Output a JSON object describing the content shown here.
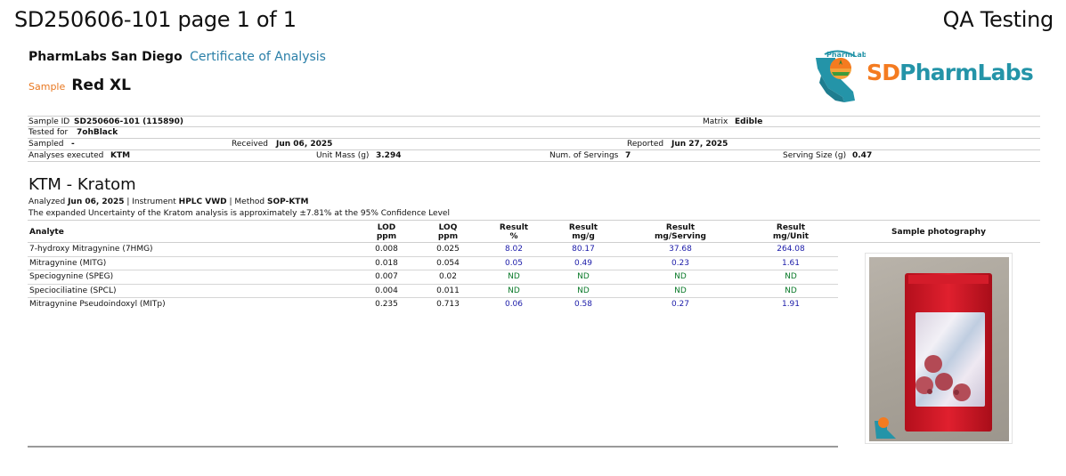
{
  "page": {
    "title": "SD250606-101 page 1 of 1",
    "right_title": "QA Testing"
  },
  "lab": {
    "name": "PharmLabs San Diego",
    "doc_type": "Certificate of Analysis",
    "logo_text_sd": "SD",
    "logo_text_rest": "PharmLabs",
    "logo_badge": "PharmLabs"
  },
  "sample": {
    "label": "Sample",
    "name": "Red XL"
  },
  "info": {
    "sample_id_label": "Sample ID",
    "sample_id": "SD250606-101 (115890)",
    "matrix_label": "Matrix",
    "matrix": "Edible",
    "tested_for_label": "Tested for",
    "tested_for": "7ohBlack",
    "sampled_label": "Sampled",
    "sampled": "-",
    "received_label": "Received",
    "received": "Jun 06, 2025",
    "reported_label": "Reported",
    "reported": "Jun 27, 2025",
    "analyses_label": "Analyses executed",
    "analyses": "KTM",
    "unit_mass_label": "Unit Mass (g)",
    "unit_mass": "3.294",
    "servings_label": "Num. of Servings",
    "servings": "7",
    "serving_size_label": "Serving Size (g)",
    "serving_size": "0.47"
  },
  "section": {
    "title": "KTM - Kratom",
    "analyzed_prefix": "Analyzed",
    "analyzed_date": "Jun 06, 2025",
    "instrument_prefix": "| Instrument",
    "instrument": "HPLC VWD",
    "method_prefix": "| Method",
    "method": "SOP-KTM",
    "uncertainty": "The expanded Uncertainty of the Kratom analysis is approximately ±7.81% at the 95% Confidence Level"
  },
  "table": {
    "headers": {
      "analyte": "Analyte",
      "lod": [
        "LOD",
        "ppm"
      ],
      "loq": [
        "LOQ",
        "ppm"
      ],
      "pct": [
        "Result",
        "%"
      ],
      "mgg": [
        "Result",
        "mg/g"
      ],
      "mgserv": [
        "Result",
        "mg/Serving"
      ],
      "mgunit": [
        "Result",
        "mg/Unit"
      ],
      "photo": "Sample photography"
    },
    "rows": [
      {
        "analyte": "7-hydroxy Mitragynine (7HMG)",
        "lod": "0.008",
        "loq": "0.025",
        "pct": "8.02",
        "mgg": "80.17",
        "mgserv": "37.68",
        "mgunit": "264.08"
      },
      {
        "analyte": "Mitragynine (MITG)",
        "lod": "0.018",
        "loq": "0.054",
        "pct": "0.05",
        "mgg": "0.49",
        "mgserv": "0.23",
        "mgunit": "1.61"
      },
      {
        "analyte": "Speciogynine (SPEG)",
        "lod": "0.007",
        "loq": "0.02",
        "pct": "ND",
        "mgg": "ND",
        "mgserv": "ND",
        "mgunit": "ND"
      },
      {
        "analyte": "Speciociliatine (SPCL)",
        "lod": "0.004",
        "loq": "0.011",
        "pct": "ND",
        "mgg": "ND",
        "mgserv": "ND",
        "mgunit": "ND"
      },
      {
        "analyte": "Mitragynine Pseudoindoxyl (MITp)",
        "lod": "0.235",
        "loq": "0.713",
        "pct": "0.06",
        "mgg": "0.58",
        "mgserv": "0.27",
        "mgunit": "1.91"
      }
    ]
  },
  "colors": {
    "accent_blue": "#2a7fa8",
    "sample_orange": "#e8771f",
    "result_blue": "#1a1aa8",
    "nd_green": "#0b7a2a"
  }
}
